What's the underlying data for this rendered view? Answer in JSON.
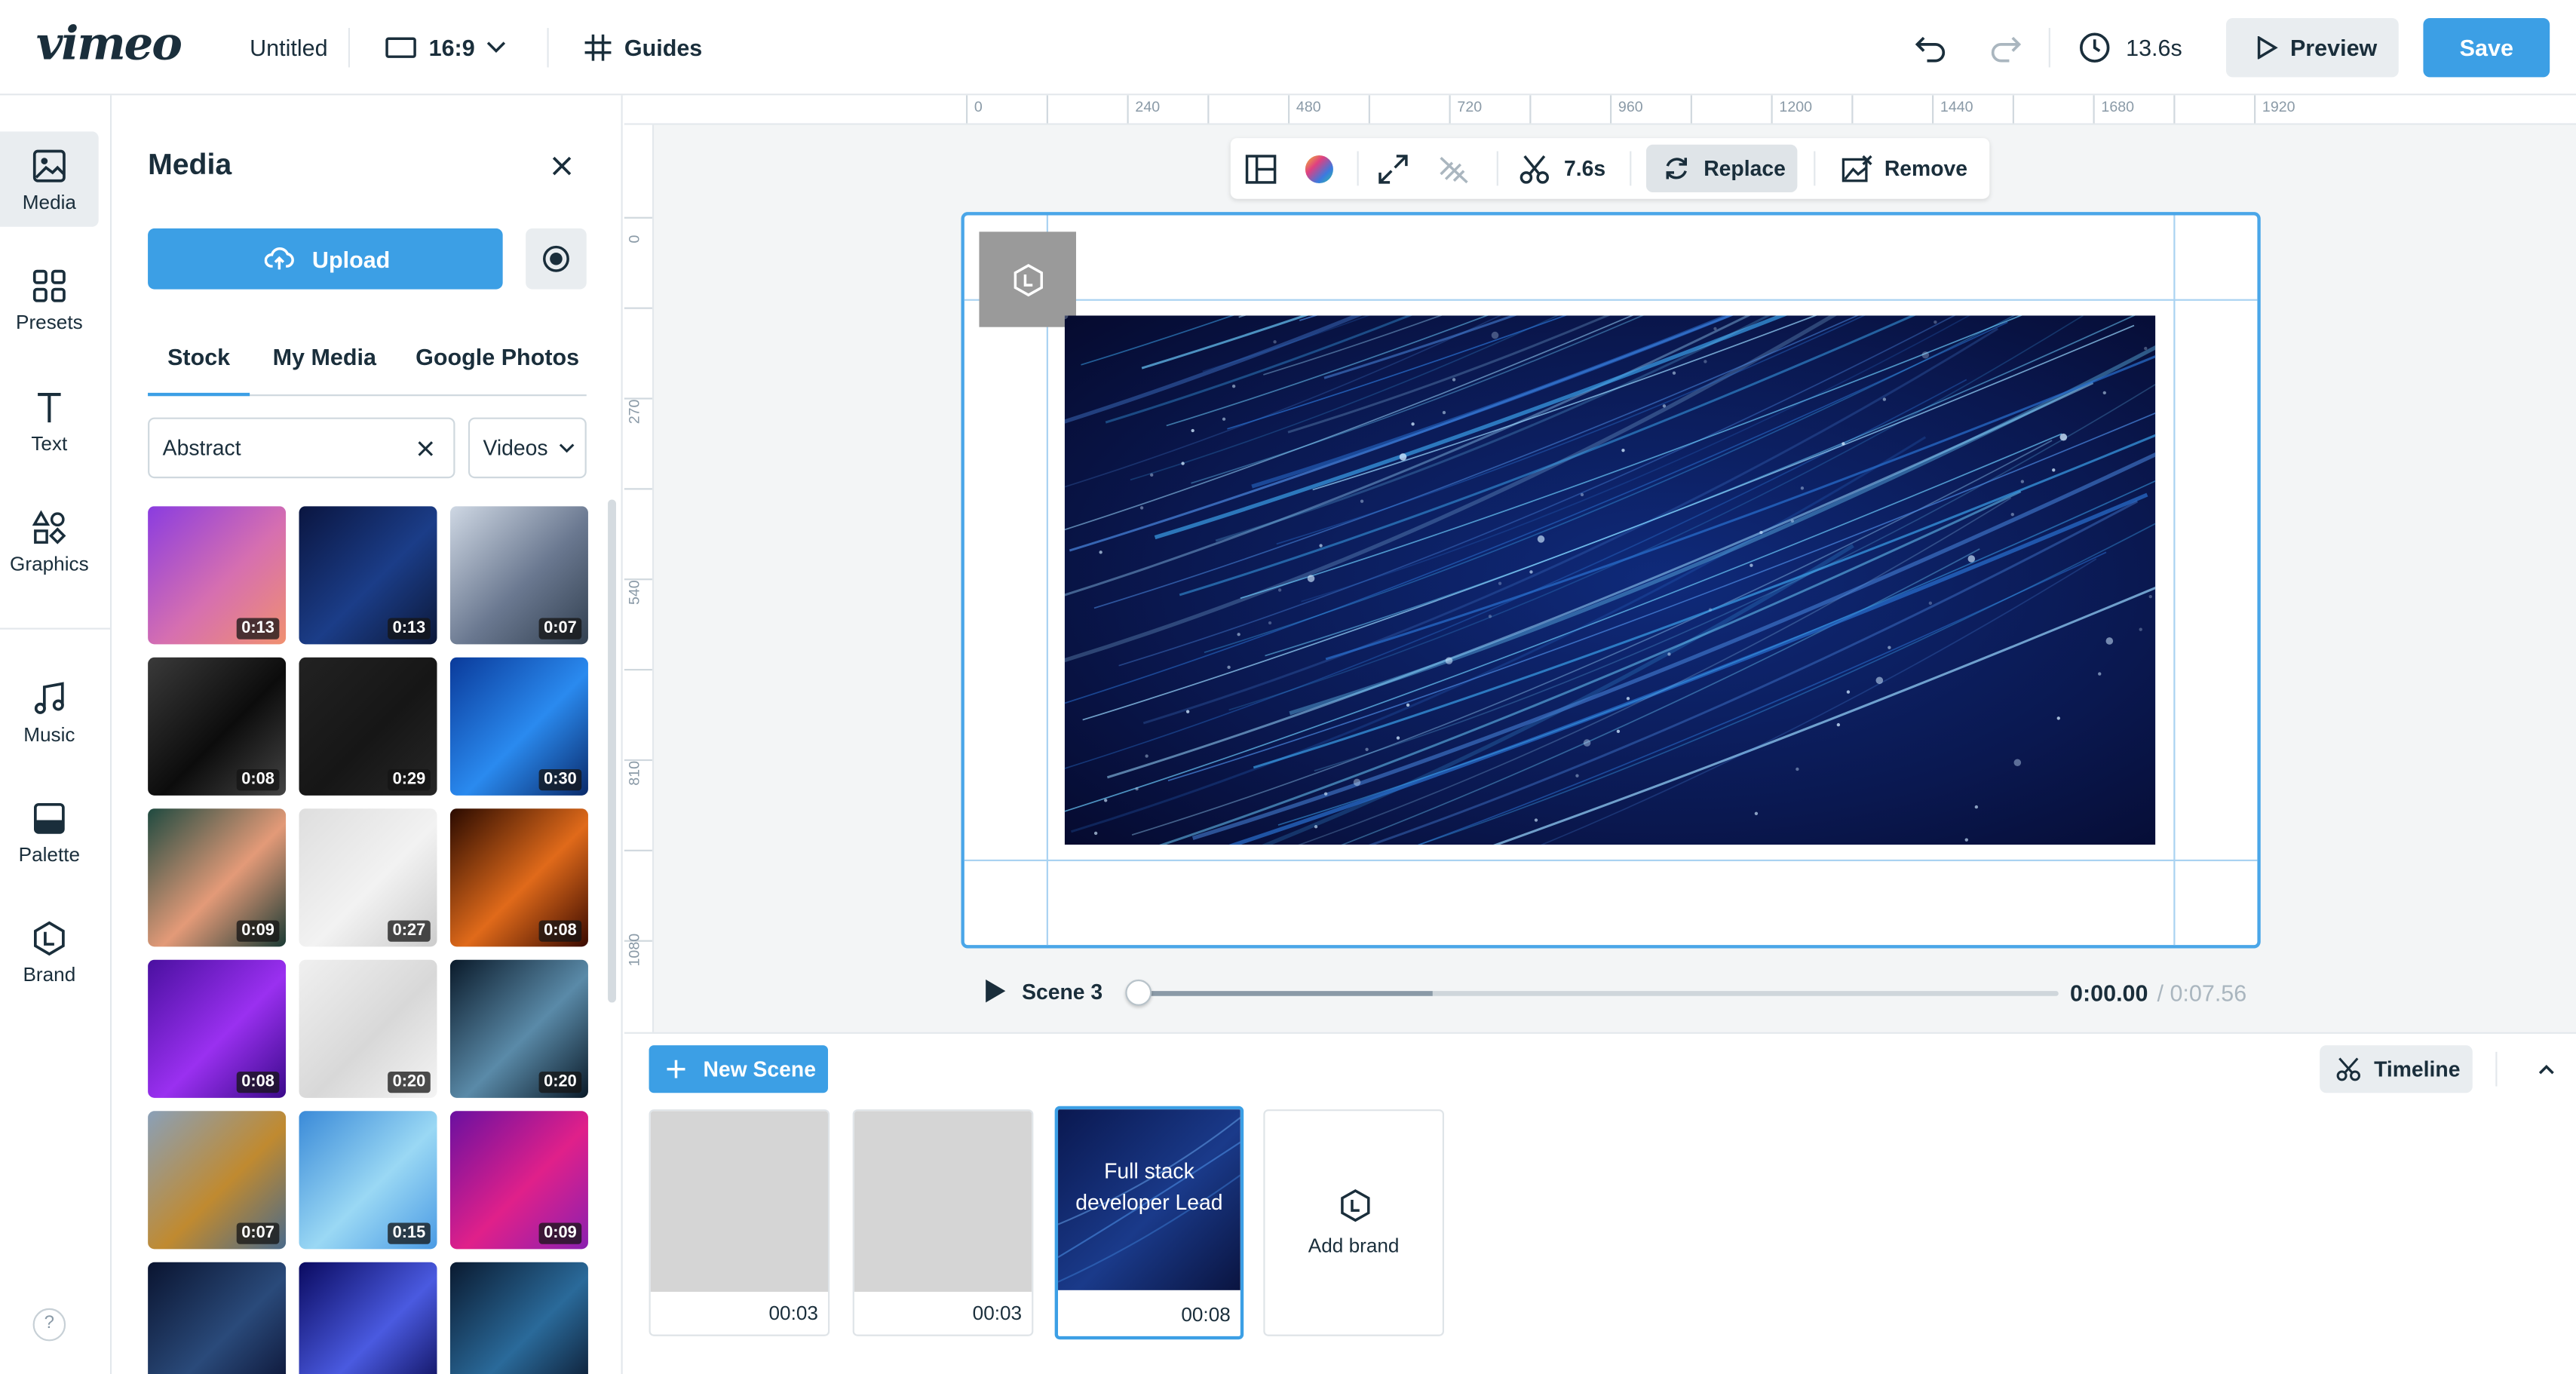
{
  "header": {
    "logo": "vimeo",
    "project_title": "Untitled",
    "aspect_ratio": "16:9",
    "guides_label": "Guides",
    "duration": "13.6s",
    "preview_label": "Preview",
    "save_label": "Save"
  },
  "rail": {
    "items": [
      {
        "label": "Media",
        "icon": "image-icon",
        "active": true
      },
      {
        "label": "Presets",
        "icon": "grid-icon"
      },
      {
        "label": "Text",
        "icon": "text-icon"
      },
      {
        "label": "Graphics",
        "icon": "shapes-icon"
      },
      {
        "label": "Music",
        "icon": "music-icon"
      },
      {
        "label": "Palette",
        "icon": "palette-icon"
      },
      {
        "label": "Brand",
        "icon": "brand-icon"
      }
    ],
    "help": "?"
  },
  "media_panel": {
    "title": "Media",
    "upload_label": "Upload",
    "tabs": [
      "Stock",
      "My Media",
      "Google Photos"
    ],
    "active_tab": "Stock",
    "search_value": "Abstract",
    "filter_value": "Videos",
    "thumbnails": [
      {
        "duration": "0:13",
        "colors": [
          "#8a3ce0",
          "#d66fb0",
          "#f09070"
        ]
      },
      {
        "duration": "0:13",
        "colors": [
          "#0a1540",
          "#1b3d88",
          "#0c1838"
        ]
      },
      {
        "duration": "0:07",
        "colors": [
          "#cfd8e4",
          "#6a7890",
          "#324050"
        ]
      },
      {
        "duration": "0:08",
        "colors": [
          "#3a3a3a",
          "#0c0c0c",
          "#444444"
        ]
      },
      {
        "duration": "0:29",
        "colors": [
          "#222222",
          "#161616",
          "#262626"
        ]
      },
      {
        "duration": "0:30",
        "colors": [
          "#0a3a9a",
          "#2a8aef",
          "#0a2a6a"
        ]
      },
      {
        "duration": "0:09",
        "colors": [
          "#1f4a40",
          "#e39a78",
          "#1a3a34"
        ]
      },
      {
        "duration": "0:27",
        "colors": [
          "#dedede",
          "#f2f2f2",
          "#cccccc"
        ]
      },
      {
        "duration": "0:08",
        "colors": [
          "#2a0a00",
          "#e06a1a",
          "#3a0a00"
        ]
      },
      {
        "duration": "0:08",
        "colors": [
          "#4a10a0",
          "#9a30f0",
          "#3a0a8a"
        ]
      },
      {
        "duration": "0:20",
        "colors": [
          "#f0f0f0",
          "#d8d8d8",
          "#f4f4f4"
        ]
      },
      {
        "duration": "0:20",
        "colors": [
          "#0a1a2a",
          "#5a8aa8",
          "#0a1a28"
        ]
      },
      {
        "duration": "0:07",
        "colors": [
          "#8aa0b8",
          "#c08a30",
          "#4a6a8a"
        ]
      },
      {
        "duration": "0:15",
        "colors": [
          "#3a8ad8",
          "#9ad8f4",
          "#4a9ae4"
        ]
      },
      {
        "duration": "0:09",
        "colors": [
          "#6a10a0",
          "#e0208a",
          "#8a20b0"
        ]
      },
      {
        "duration": "",
        "colors": [
          "#0a1430",
          "#2a4a7a",
          "#0a1030"
        ]
      },
      {
        "duration": "",
        "colors": [
          "#0a0a60",
          "#4a5ae0",
          "#0a0a50"
        ]
      },
      {
        "duration": "",
        "colors": [
          "#0a1a30",
          "#2a6a9a",
          "#0a1428"
        ]
      }
    ]
  },
  "canvas_toolbar": {
    "trim_duration": "7.6s",
    "replace_label": "Replace",
    "remove_label": "Remove"
  },
  "ruler": {
    "top": [
      "0",
      "240",
      "480",
      "720",
      "960",
      "1200",
      "1440",
      "1680",
      "1920"
    ],
    "left": [
      "0",
      "270",
      "540",
      "810",
      "1080"
    ]
  },
  "playback": {
    "scene_label": "Scene 3",
    "current_time": "0:00.00",
    "total_time": "/ 0:07.56",
    "progress_fraction": 0
  },
  "timeline": {
    "new_scene_label": "New Scene",
    "timeline_label": "Timeline",
    "scenes": [
      {
        "time": "00:03",
        "text": ""
      },
      {
        "time": "00:03",
        "text": ""
      },
      {
        "time": "00:08",
        "text": "Full stack developer Lead",
        "active": true
      }
    ],
    "add_brand_label": "Add brand"
  },
  "colors": {
    "accent": "#3c9fe5",
    "selection": "#4aa6e8"
  }
}
